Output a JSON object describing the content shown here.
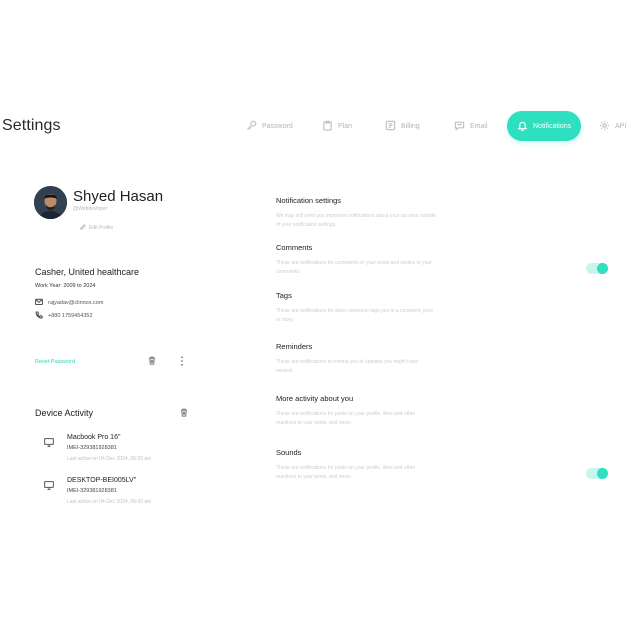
{
  "header": {
    "title": "Settings"
  },
  "tabs": [
    {
      "label": "Password",
      "icon": "key-icon"
    },
    {
      "label": "Plan",
      "icon": "clipboard-icon"
    },
    {
      "label": "Billing",
      "icon": "billing-icon"
    },
    {
      "label": "Email",
      "icon": "chat-icon"
    },
    {
      "label": "Notifications",
      "icon": "bell-icon",
      "active": true
    },
    {
      "label": "API",
      "icon": "gear-icon"
    }
  ],
  "profile": {
    "name": "Shyed Hasan",
    "handle": "@Webdevloper",
    "edit_label": "Edit Profile",
    "job_title": "Casher, United healthcare",
    "work_year": "Work Year: 2009 to 2024",
    "email": "rajyadav@clinnox.com",
    "phone": "+880 1759454352",
    "reset_password": "Reset Password"
  },
  "device_activity": {
    "title": "Device Activity",
    "devices": [
      {
        "name": "Macbook Pro 16\"",
        "imei": "IMEI-329381928381",
        "last_active": "Last active on 04 Dec 2024, 06:29 am"
      },
      {
        "name": "DESKTOP-BEI005LV\"",
        "imei": "IMEI-329381928381",
        "last_active": "Last active on 04 Dec 2024, 06:43 am"
      }
    ]
  },
  "notifications": {
    "heading": "Notification settings",
    "heading_desc": "We may still send you important notifications about your account outside of your notification settings.",
    "items": [
      {
        "title": "Comments",
        "desc": "These are notifications for comments on your posts and replies to your comments.",
        "enabled": true
      },
      {
        "title": "Tags",
        "desc": "These are notifications for when someone tags you in a comment, post or story.",
        "enabled": false
      },
      {
        "title": "Reminders",
        "desc": "These are notifications to remind you of updates you might have missed.",
        "enabled": false
      },
      {
        "title": "More activity about you",
        "desc": "These are notifications for posts on your profile, likes and other reactions to your posts, and more.",
        "enabled": false
      },
      {
        "title": "Sounds",
        "desc": "These are notifications for posts on your profile, likes and other reactions to your posts, and more.",
        "enabled": true
      }
    ]
  },
  "colors": {
    "accent": "#2ee0c0",
    "accent_light": "#c9f5ec"
  }
}
